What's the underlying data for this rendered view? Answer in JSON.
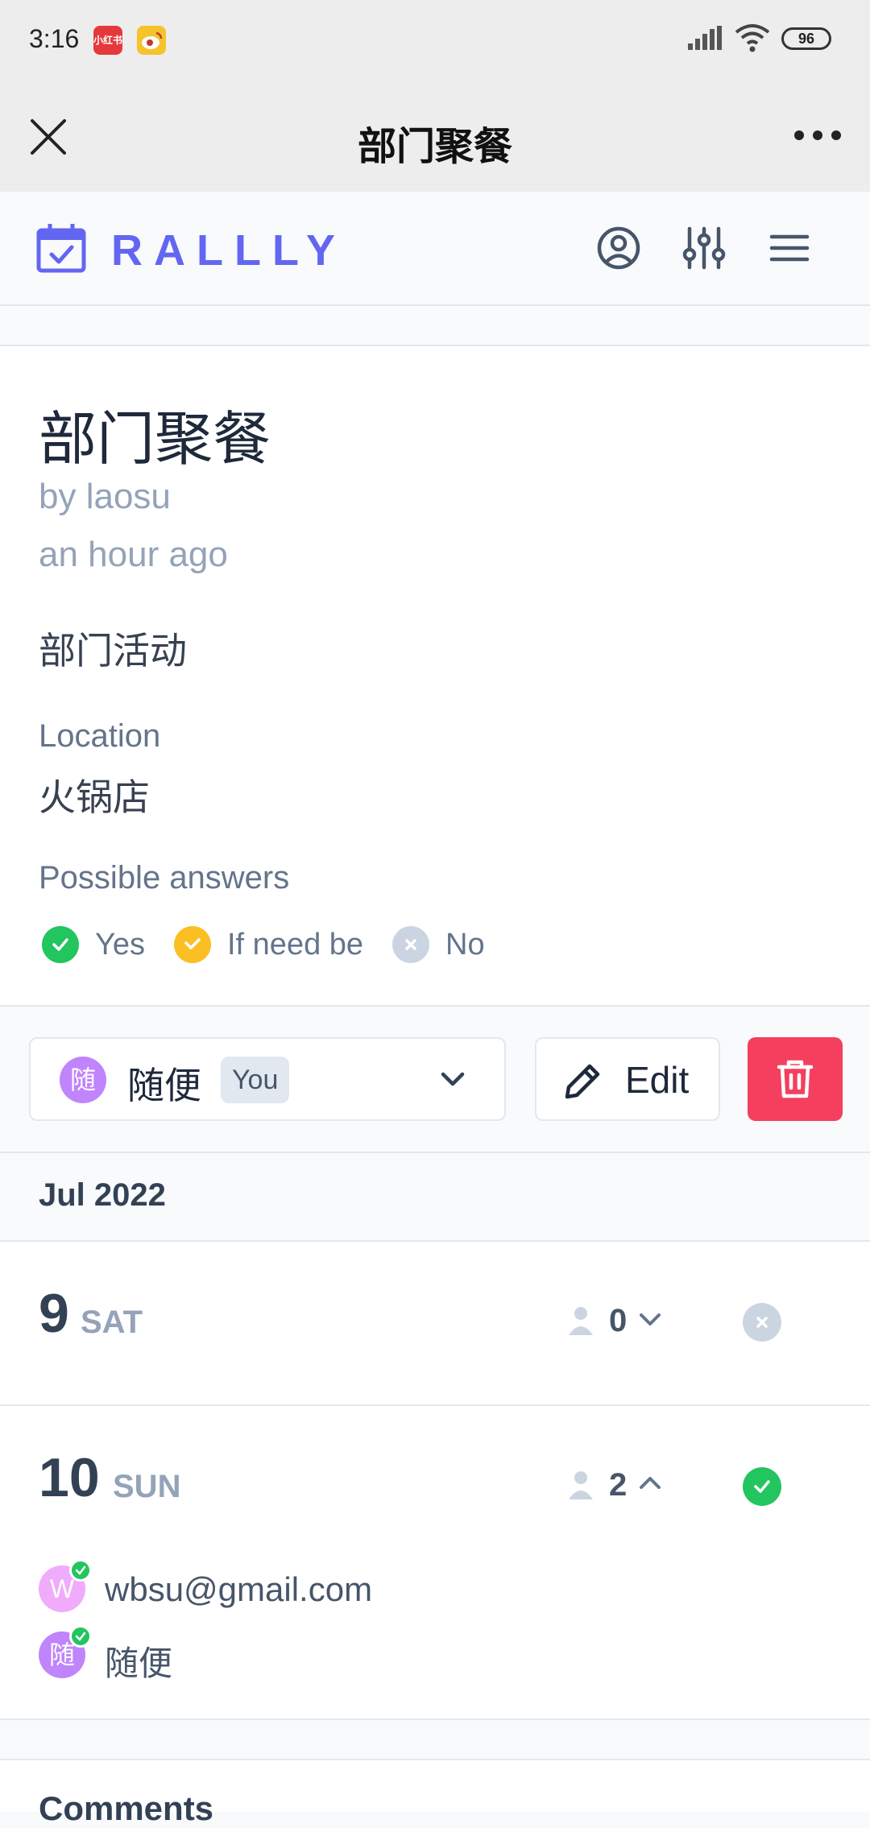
{
  "status_bar": {
    "time": "3:16",
    "app_badges": [
      "小红书",
      "微博"
    ],
    "battery": "96"
  },
  "webview": {
    "title": "部门聚餐"
  },
  "app": {
    "brand": "RALLLY",
    "brand_color": "#6366f1"
  },
  "poll": {
    "title": "部门聚餐",
    "author": "by laosu",
    "created": "an hour ago",
    "description": "部门活动",
    "location_label": "Location",
    "location": "火锅店",
    "answers_label": "Possible answers",
    "answers": [
      {
        "label": "Yes",
        "color": "#22c55e",
        "icon": "check-icon"
      },
      {
        "label": "If need be",
        "color": "#fbbf24",
        "icon": "check-icon"
      },
      {
        "label": "No",
        "color": "#cbd5e1",
        "icon": "x-icon"
      }
    ]
  },
  "participant_select": {
    "avatar": "随",
    "name": "随便",
    "badge": "You"
  },
  "actions": {
    "edit_label": "Edit",
    "delete_color": "#f43f5e"
  },
  "month": "Jul 2022",
  "options": [
    {
      "day": "9",
      "dow": "SAT",
      "count": "0",
      "expanded": false,
      "status": "no"
    },
    {
      "day": "10",
      "dow": "SUN",
      "count": "2",
      "expanded": true,
      "status": "yes",
      "participants": [
        {
          "initial": "W",
          "name": "wbsu@gmail.com",
          "color": "#f0abfc"
        },
        {
          "initial": "随",
          "name": "随便",
          "color": "#c084fc"
        }
      ]
    }
  ],
  "comments_title": "Comments"
}
